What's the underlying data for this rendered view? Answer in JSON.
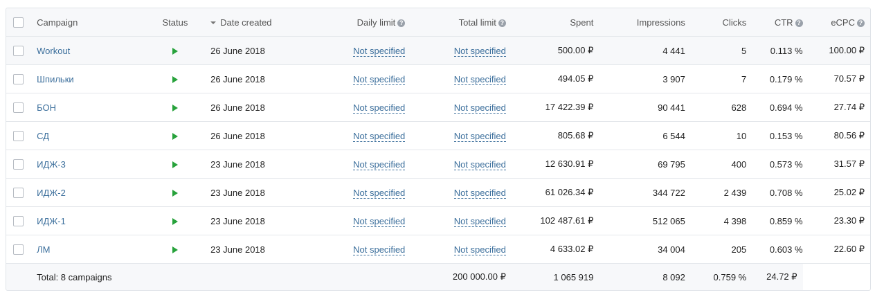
{
  "header": {
    "campaign": "Campaign",
    "status": "Status",
    "date_created": "Date created",
    "daily_limit": "Daily limit",
    "total_limit": "Total limit",
    "spent": "Spent",
    "impressions": "Impressions",
    "clicks": "Clicks",
    "ctr": "CTR",
    "ecpc": "eCPC",
    "help_glyph": "?"
  },
  "rows": [
    {
      "name": "Workout",
      "date": "26 June 2018",
      "daily": "Not specified",
      "total": "Not specified",
      "spent": "500.00 ₽",
      "impressions": "4 441",
      "clicks": "5",
      "ctr": "0.113 %",
      "ecpc": "100.00 ₽"
    },
    {
      "name": "Шпильки",
      "date": "26 June 2018",
      "daily": "Not specified",
      "total": "Not specified",
      "spent": "494.05 ₽",
      "impressions": "3 907",
      "clicks": "7",
      "ctr": "0.179 %",
      "ecpc": "70.57 ₽"
    },
    {
      "name": "БОН",
      "date": "26 June 2018",
      "daily": "Not specified",
      "total": "Not specified",
      "spent": "17 422.39 ₽",
      "impressions": "90 441",
      "clicks": "628",
      "ctr": "0.694 %",
      "ecpc": "27.74 ₽"
    },
    {
      "name": "СД",
      "date": "26 June 2018",
      "daily": "Not specified",
      "total": "Not specified",
      "spent": "805.68 ₽",
      "impressions": "6 544",
      "clicks": "10",
      "ctr": "0.153 %",
      "ecpc": "80.56 ₽"
    },
    {
      "name": "ИДЖ-3",
      "date": "23 June 2018",
      "daily": "Not specified",
      "total": "Not specified",
      "spent": "12 630.91 ₽",
      "impressions": "69 795",
      "clicks": "400",
      "ctr": "0.573 %",
      "ecpc": "31.57 ₽"
    },
    {
      "name": "ИДЖ-2",
      "date": "23 June 2018",
      "daily": "Not specified",
      "total": "Not specified",
      "spent": "61 026.34 ₽",
      "impressions": "344 722",
      "clicks": "2 439",
      "ctr": "0.708 %",
      "ecpc": "25.02 ₽"
    },
    {
      "name": "ИДЖ-1",
      "date": "23 June 2018",
      "daily": "Not specified",
      "total": "Not specified",
      "spent": "102 487.61 ₽",
      "impressions": "512 065",
      "clicks": "4 398",
      "ctr": "0.859 %",
      "ecpc": "23.30 ₽"
    },
    {
      "name": "ЛМ",
      "date": "23 June 2018",
      "daily": "Not specified",
      "total": "Not specified",
      "spent": "4 633.02 ₽",
      "impressions": "34 004",
      "clicks": "205",
      "ctr": "0.603 %",
      "ecpc": "22.60 ₽"
    }
  ],
  "totals": {
    "label": "Total: 8 campaigns",
    "spent": "200 000.00 ₽",
    "impressions": "1 065 919",
    "clicks": "8 092",
    "ctr": "0.759 %",
    "ecpc": "24.72 ₽"
  },
  "status_icon": "play-icon",
  "colors": {
    "link": "#3c6f9c",
    "play": "#27a23b"
  }
}
